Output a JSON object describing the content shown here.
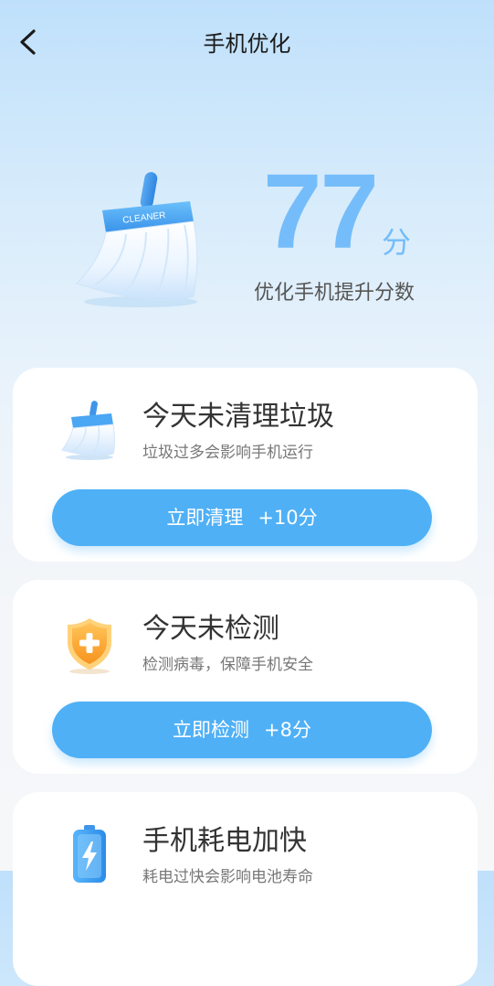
{
  "header": {
    "title": "手机优化",
    "back_icon": "chevron-left-icon"
  },
  "hero": {
    "score": "77",
    "score_unit": "分",
    "caption": "优化手机提升分数",
    "broom_label": "CLEANER",
    "accent_color": "#74bdfa"
  },
  "cards": [
    {
      "title": "今天未清理垃圾",
      "desc": "垃圾过多会影响手机运行",
      "button_label": "立即清理",
      "button_bonus": "+10分",
      "icon": "broom-icon"
    },
    {
      "title": "今天未检测",
      "desc": "检测病毒，保障手机安全",
      "button_label": "立即检测",
      "button_bonus": "+8分",
      "icon": "shield-plus-icon"
    },
    {
      "title": "手机耗电加快",
      "desc": "耗电过快会影响电池寿命",
      "icon": "battery-bolt-icon"
    }
  ],
  "button_color": "#4fb0f6"
}
